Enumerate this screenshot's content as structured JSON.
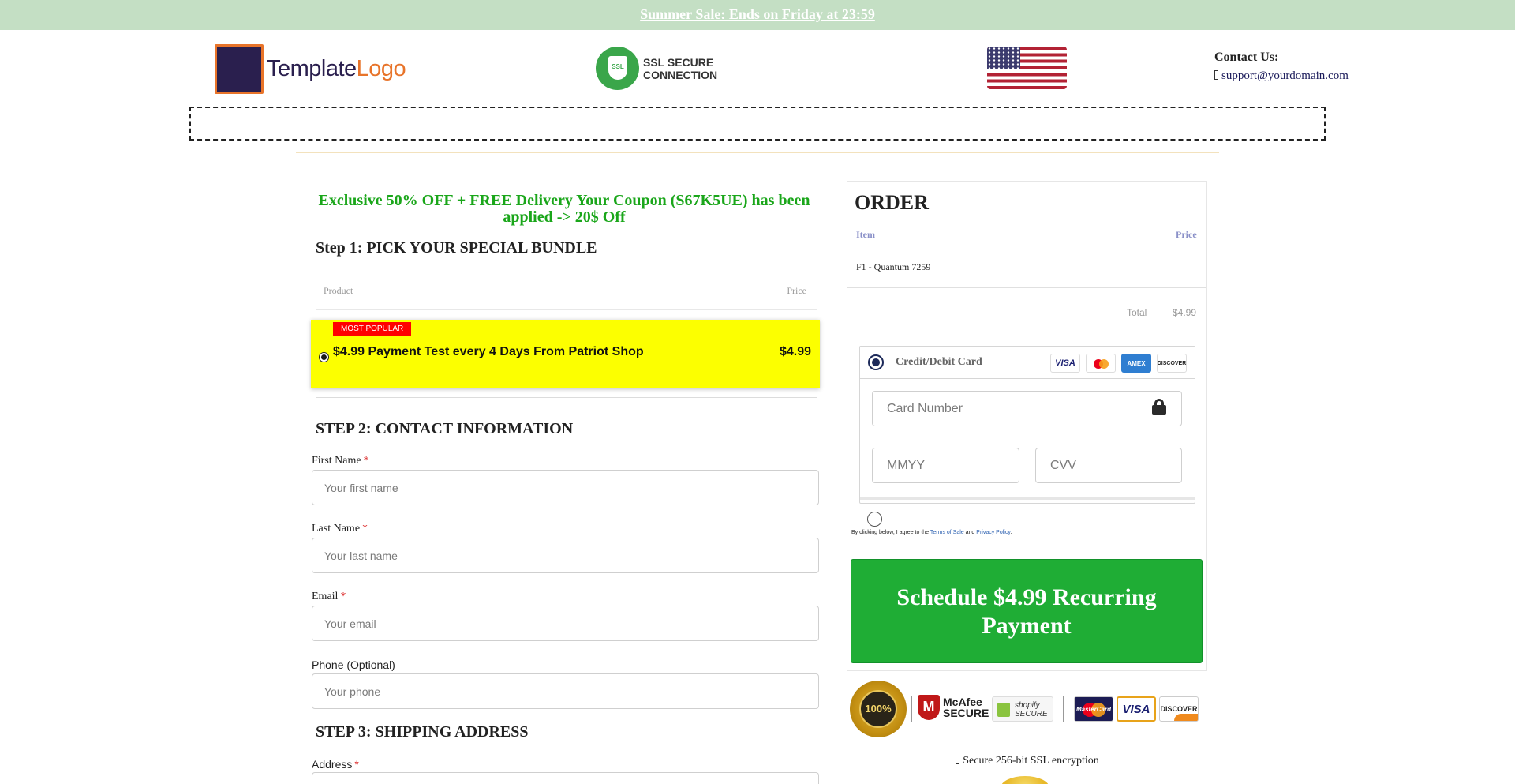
{
  "topbar": {
    "text": "Summer Sale: Ends on Friday at 23:59"
  },
  "header": {
    "logo_text_1": "Template",
    "logo_text_2": "Logo",
    "ssl_line_1": "SSL SECURE",
    "ssl_line_2": "CONNECTION",
    "ssl_badge": "SSL",
    "contact_title": "Contact Us:",
    "contact_email": "support@yourdomain.com"
  },
  "coupon": {
    "text": "Exclusive 50% OFF + FREE Delivery Your Coupon (S67K5UE) has been applied -> 20$ Off"
  },
  "step1": {
    "heading": "Step 1: PICK YOUR SPECIAL BUNDLE",
    "col_product": "Product",
    "col_price": "Price",
    "bundle": {
      "badge": "MOST POPULAR",
      "name": "$4.99 Payment Test every 4 Days From Patriot Shop",
      "price": "$4.99",
      "selected": true
    }
  },
  "step2": {
    "heading": "STEP 2: CONTACT INFORMATION",
    "first_name": {
      "label": "First Name",
      "required": "*",
      "placeholder": "Your first name"
    },
    "last_name": {
      "label": "Last Name",
      "required": "*",
      "placeholder": "Your last name"
    },
    "email": {
      "label": "Email",
      "required": "*",
      "placeholder": "Your email"
    },
    "phone": {
      "label": "Phone (Optional)",
      "placeholder": "Your phone"
    }
  },
  "step3": {
    "heading": "STEP 3: SHIPPING ADDRESS",
    "address": {
      "label": "Address",
      "required": "*"
    }
  },
  "order": {
    "title": "ORDER",
    "col_item": "Item",
    "col_price": "Price",
    "item_name": "F1 - Quantum 7259",
    "total_label": "Total",
    "total_value": "$4.99"
  },
  "payment": {
    "method_label": "Credit/Debit Card",
    "cards": [
      "VISA",
      "MasterCard",
      "AMEX",
      "DISCOVER"
    ],
    "card_number_placeholder": "Card Number",
    "expiry_placeholder": "MMYY",
    "cvv_placeholder": "CVV"
  },
  "agree": {
    "prefix": "By clicking below, I agree to the",
    "terms": "Terms of Sale",
    "and": "and",
    "privacy": "Privacy Policy",
    "suffix": "."
  },
  "cta": {
    "label": "Schedule $4.99 Recurring Payment"
  },
  "trust": {
    "seal_text": "100%",
    "mcafee_1": "McAfee",
    "mcafee_2": "SECURE",
    "shopify_1": "shopify",
    "shopify_2": "SECURE",
    "mc_text": "MasterCard",
    "visa_text": "VISA",
    "discover_text": "DISCOVER"
  },
  "secure_line": "Secure 256-bit SSL encryption",
  "colors": {
    "topbar_bg": "#c4dfc4",
    "coupon_green": "#1aa61a",
    "bundle_yellow": "#fcff00",
    "badge_red": "#ff0000",
    "cta_green": "#1fad35",
    "brand_navy": "#2a1f4e",
    "brand_orange": "#e8742a"
  }
}
